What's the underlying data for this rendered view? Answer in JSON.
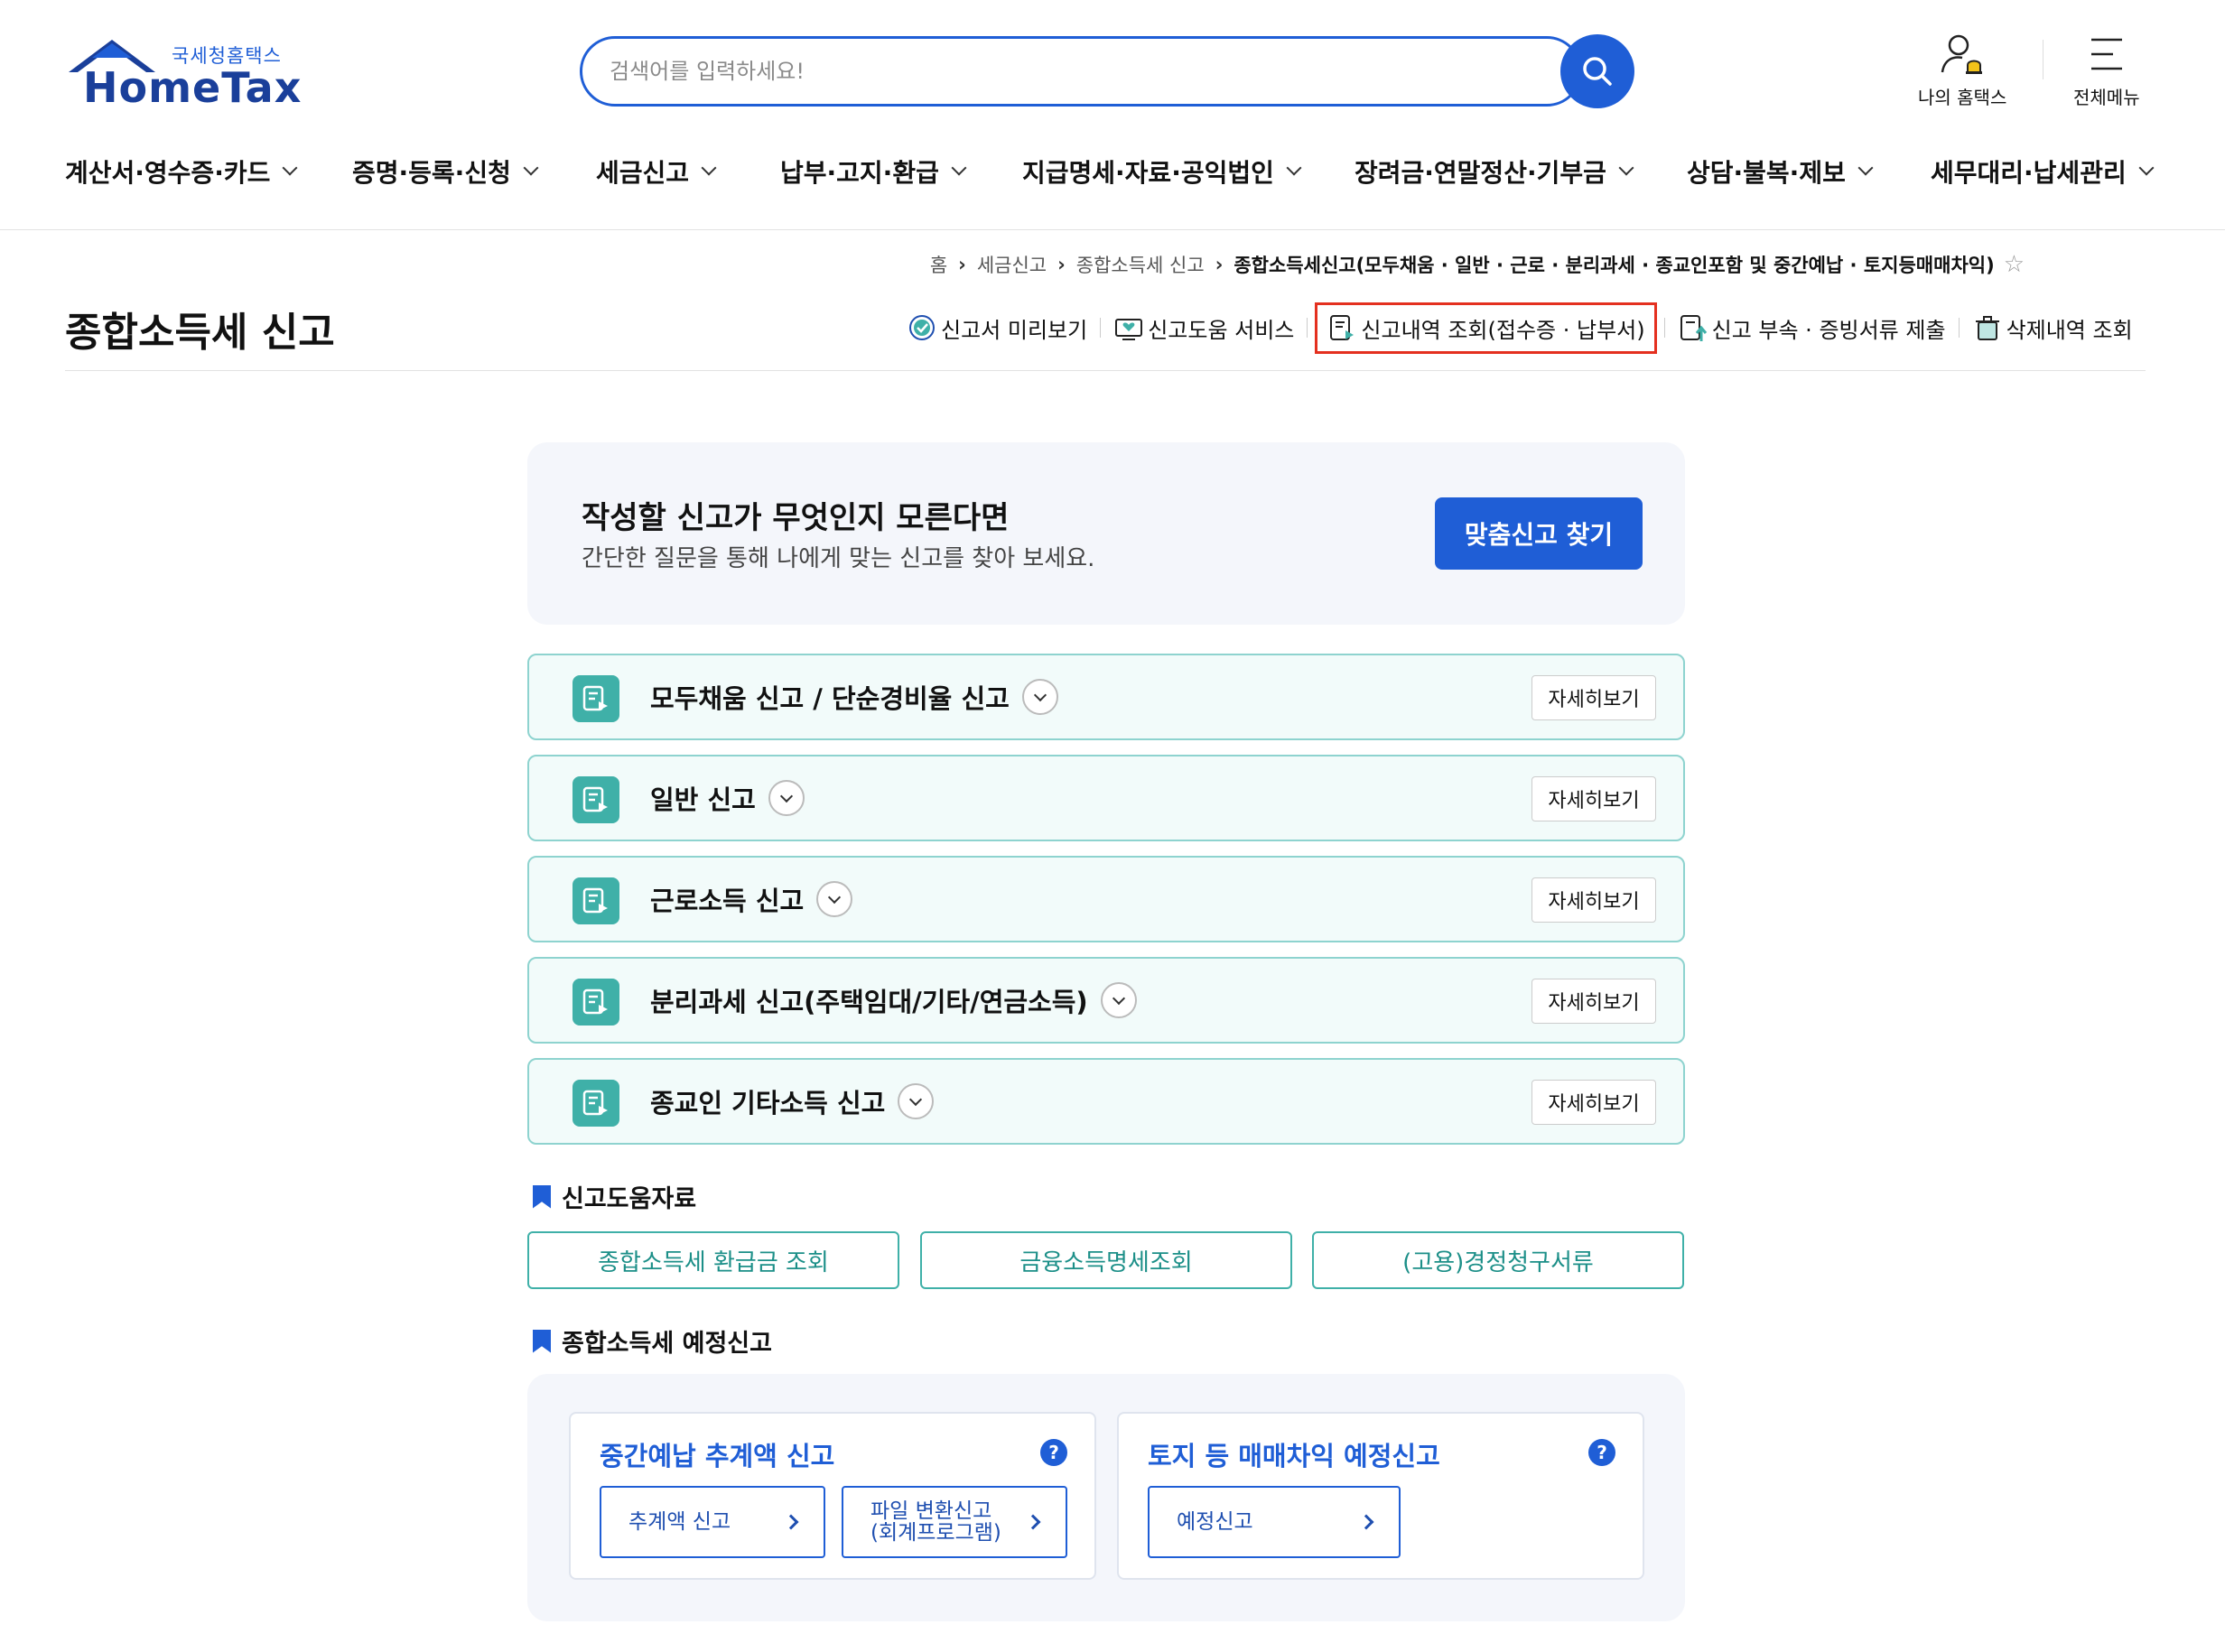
{
  "logo": {
    "sub": "국세청홈택스",
    "main": "HomeTax"
  },
  "search": {
    "placeholder": "검색어를 입력하세요!"
  },
  "util": {
    "my": "나의 홈택스",
    "menu": "전체메뉴"
  },
  "nav": [
    "계산서·영수증·카드",
    "증명·등록·신청",
    "세금신고",
    "납부·고지·환급",
    "지급명세·자료·공익법인",
    "장려금·연말정산·기부금",
    "상담·불복·제보",
    "세무대리·납세관리"
  ],
  "breadcrumb": [
    "홈",
    "세금신고",
    "종합소득세 신고",
    "종합소득세신고(모두채움 · 일반 · 근로 · 분리과세 · 종교인포함 및 중간예납 · 토지등매매차익)"
  ],
  "page_title": "종합소득세 신고",
  "actions": [
    "신고서 미리보기",
    "신고도움 서비스",
    "신고내역 조회(접수증 · 납부서)",
    "신고 부속 · 증빙서류 제출",
    "삭제내역 조회"
  ],
  "banner": {
    "heading": "작성할 신고가 무엇인지 모른다면",
    "sub": "간단한 질문을 통해 나에게 맞는 신고를 찾아 보세요.",
    "button": "맞춤신고 찾기"
  },
  "rows": [
    {
      "label": "모두채움 신고 / 단순경비율 신고",
      "button": "자세히보기"
    },
    {
      "label": "일반 신고",
      "button": "자세히보기"
    },
    {
      "label": "근로소득 신고",
      "button": "자세히보기"
    },
    {
      "label": "분리과세 신고(주택임대/기타/연금소득)",
      "button": "자세히보기"
    },
    {
      "label": "종교인 기타소득 신고",
      "button": "자세히보기"
    }
  ],
  "help": {
    "title": "신고도움자료",
    "buttons": [
      "종합소득세 환급금 조회",
      "금융소득명세조회",
      "(고용)경정청구서류"
    ]
  },
  "estimate": {
    "title": "종합소득세 예정신고",
    "cards": [
      {
        "title": "중간예납 추계액 신고",
        "buttons": [
          [
            "추계액 신고"
          ],
          [
            "파일 변환신고",
            "(회계프로그램)"
          ]
        ]
      },
      {
        "title": "토지 등 매매차익 예정신고",
        "buttons": [
          [
            "예정신고"
          ]
        ]
      }
    ],
    "help_mark": "?"
  },
  "colors": {
    "brand": "#1f5ed6",
    "teal": "#3fb0a8",
    "highlight": "#e4301f"
  }
}
